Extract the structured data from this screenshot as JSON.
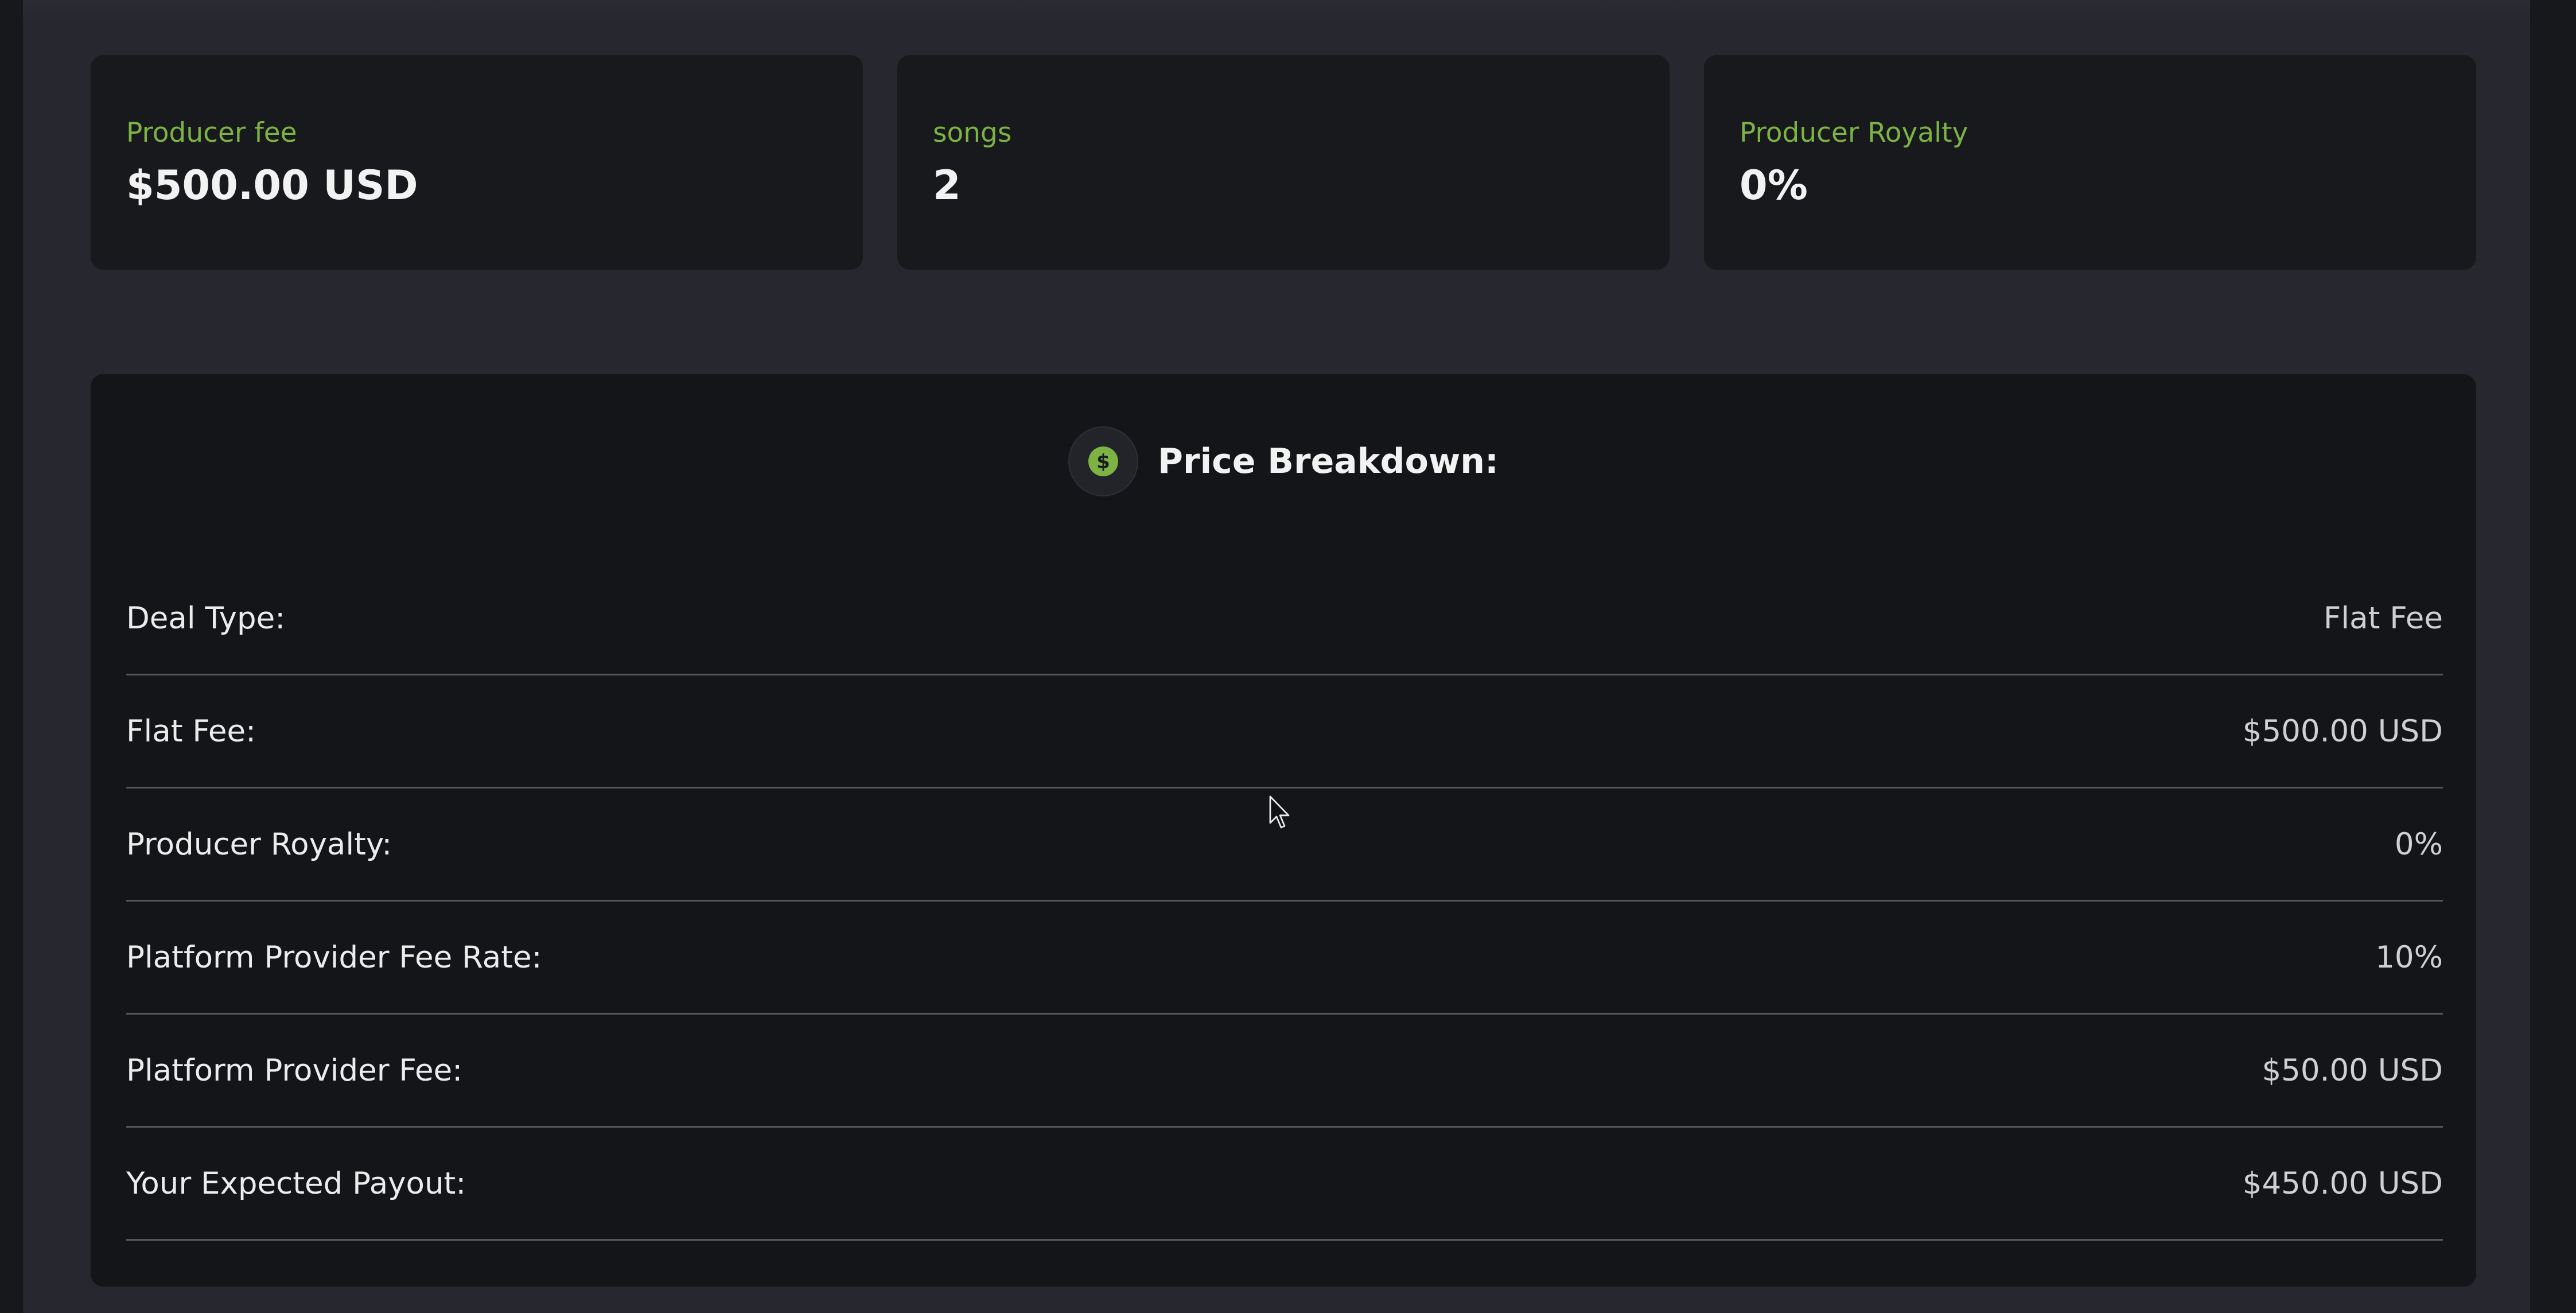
{
  "summary_cards": [
    {
      "label": "Producer fee",
      "value": "$500.00 USD"
    },
    {
      "label": "songs",
      "value": "2"
    },
    {
      "label": "Producer Royalty",
      "value": "0%"
    }
  ],
  "breakdown": {
    "title": "Price Breakdown:",
    "icon": "dollar-circle-icon",
    "rows": [
      {
        "label": "Deal Type:",
        "value": "Flat Fee"
      },
      {
        "label": "Flat Fee:",
        "value": "$500.00 USD"
      },
      {
        "label": "Producer Royalty:",
        "value": "0%"
      },
      {
        "label": "Platform Provider Fee Rate:",
        "value": "10%"
      },
      {
        "label": "Platform Provider Fee:",
        "value": "$50.00 USD"
      },
      {
        "label": "Your Expected Payout:",
        "value": "$450.00 USD"
      }
    ]
  },
  "colors": {
    "accent": "#7cb342",
    "panel": "#18191d",
    "page": "#26272f"
  }
}
